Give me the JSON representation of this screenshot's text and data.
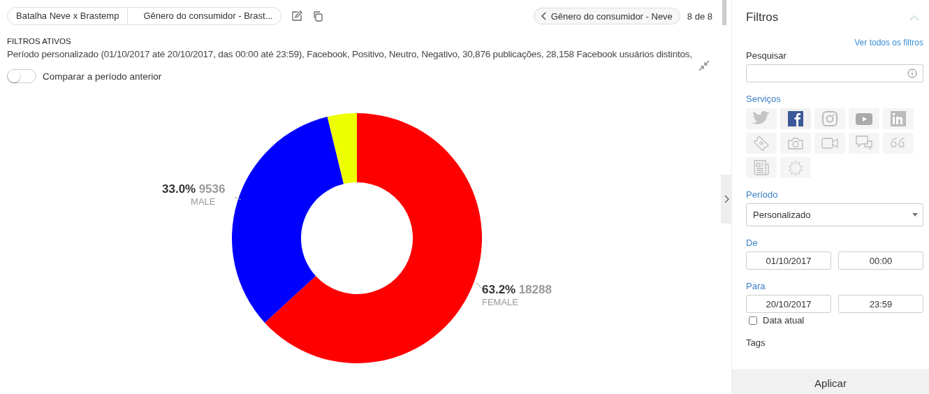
{
  "breadcrumb": [
    "Batalha Neve x Brastemp",
    "Gênero do consumidor - Brast..."
  ],
  "navigation": {
    "previous": "Gênero do consumidor - Neve",
    "position": "8 de 8"
  },
  "active_filters": {
    "title": "FILTROS ATIVOS",
    "text": "Período personalizado (01/10/2017 até 20/10/2017, das 00:00 até 23:59), Facebook, Positivo, Neutro, Negativo, 30,876 publicações, 28,158 Facebook usuários distintos,"
  },
  "compare_toggle": {
    "label": "Comparar a período anterior",
    "on": false
  },
  "chart_data": {
    "type": "donut",
    "categories": [
      "FEMALE",
      "MALE",
      null
    ],
    "values": [
      63.2,
      33.0,
      3.8
    ],
    "value_labels": [
      "63.2%",
      "33.0%",
      null
    ],
    "colors": [
      "#ff0000",
      "#0000ff",
      "#eeff00"
    ],
    "data_labels": true
  },
  "slice_counts": [
    "18288",
    "9536"
  ],
  "sidebar": {
    "title": "Filtros",
    "all_filters_link": "Ver todos os filtros",
    "search": {
      "label": "Pesquisar"
    },
    "services_label": "Serviços",
    "services": [
      {
        "kind": "twitter",
        "selected": false
      },
      {
        "kind": "facebook",
        "selected": true
      },
      {
        "kind": "instagram",
        "selected": false
      },
      {
        "kind": "youtube",
        "selected": false
      },
      {
        "kind": "linkedin",
        "selected": false
      },
      {
        "kind": "ticket",
        "selected": false
      },
      {
        "kind": "camera",
        "selected": false
      },
      {
        "kind": "video",
        "selected": false
      },
      {
        "kind": "chat",
        "selected": false
      },
      {
        "kind": "quote",
        "selected": false
      },
      {
        "kind": "news",
        "selected": false
      },
      {
        "kind": "burst",
        "selected": false
      }
    ],
    "period": {
      "label": "Período",
      "value": "Personalizado"
    },
    "from": {
      "label": "De",
      "date": "01/10/2017",
      "time": "00:00"
    },
    "to": {
      "label": "Para",
      "date": "20/10/2017",
      "time": "23:59"
    },
    "current_date": {
      "label": "Data atual",
      "checked": false
    },
    "tags_label": "Tags",
    "apply": "Aplicar"
  }
}
